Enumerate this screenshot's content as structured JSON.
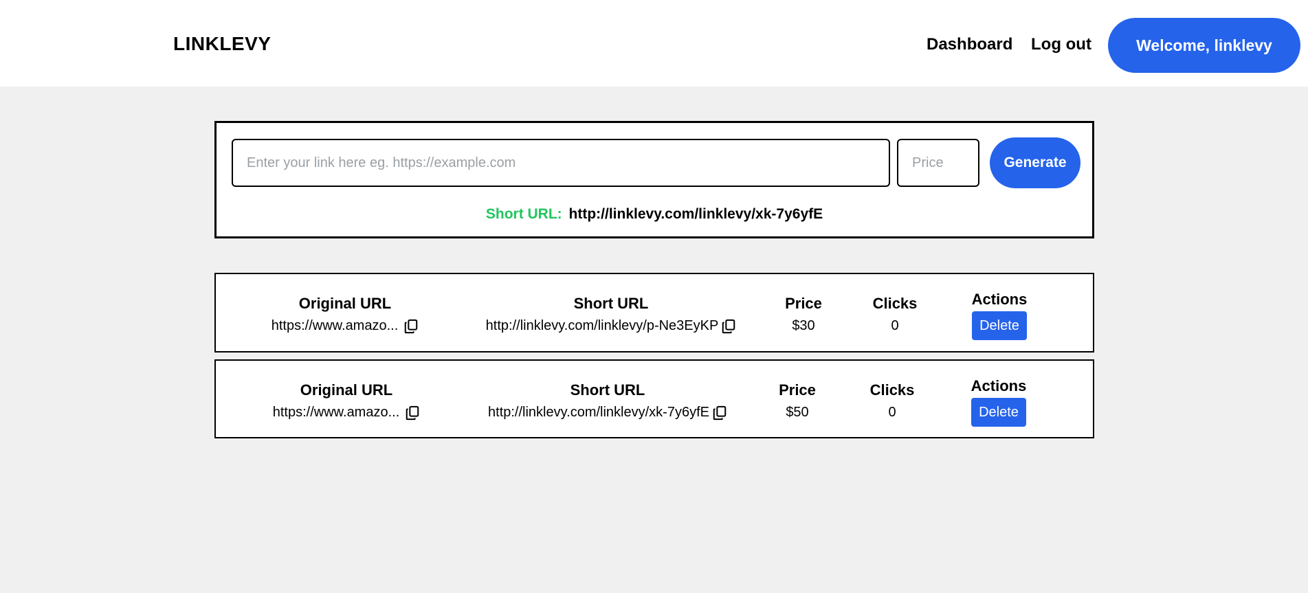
{
  "header": {
    "brand": "LINKLEVY",
    "nav": {
      "dashboard": "Dashboard",
      "logout": "Log out",
      "welcome": "Welcome, linklevy"
    }
  },
  "generator": {
    "link_placeholder": "Enter your link here eg. https://example.com",
    "link_value": "",
    "price_placeholder": "Price",
    "price_value": "",
    "generate_label": "Generate",
    "short_url_label": "Short URL:",
    "short_url_value": "http://linklevy.com/linklevy/xk-7y6yfE"
  },
  "columns": {
    "original": "Original URL",
    "short": "Short URL",
    "price": "Price",
    "clicks": "Clicks",
    "actions": "Actions"
  },
  "links": [
    {
      "original": "https://www.amazo...",
      "short": "http://linklevy.com/linklevy/p-Ne3EyKP",
      "price": "$30",
      "clicks": "0",
      "action": "Delete"
    },
    {
      "original": "https://www.amazo...",
      "short": "http://linklevy.com/linklevy/xk-7y6yfE",
      "price": "$50",
      "clicks": "0",
      "action": "Delete"
    }
  ],
  "colors": {
    "accent": "#2563eb",
    "success": "#22c55e",
    "background": "#f0f0f0"
  },
  "icons": [
    "copy-icon"
  ]
}
